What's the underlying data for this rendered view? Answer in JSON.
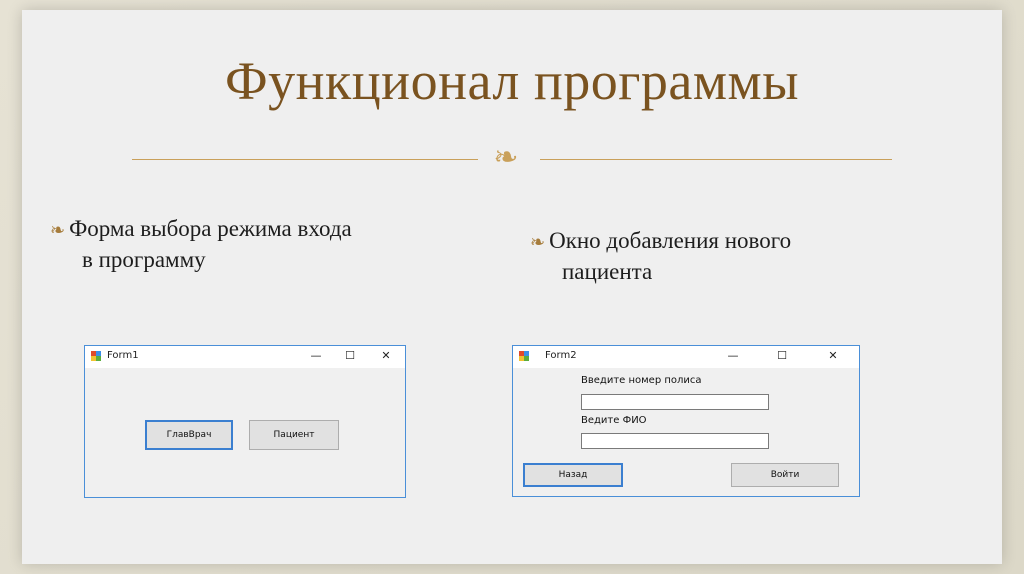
{
  "slide": {
    "title": "Функционал программы",
    "ornament": "❧",
    "bullet_mark": "☂",
    "bullets": [
      {
        "line1": "Форма выбора режима входа",
        "line2": "в программу"
      },
      {
        "line1": "Окно добавления нового",
        "line2": "пациента"
      }
    ]
  },
  "form1": {
    "title": "Form1",
    "controls": {
      "minimize": "—",
      "maximize": "☐",
      "close": "✕"
    },
    "buttons": {
      "chief_doctor": "ГлавВрач",
      "patient": "Пациент"
    }
  },
  "form2": {
    "title": "Form2",
    "controls": {
      "minimize": "—",
      "maximize": "☐",
      "close": "✕"
    },
    "labels": {
      "policy": "Введите номер полиса",
      "fio": "Ведите ФИО"
    },
    "inputs": {
      "policy_value": "",
      "fio_value": ""
    },
    "buttons": {
      "back": "Назад",
      "login": "Войти"
    }
  },
  "colors": {
    "title": "#7a5320",
    "accent": "#c9a05a",
    "window_border": "#4a8fd8"
  }
}
